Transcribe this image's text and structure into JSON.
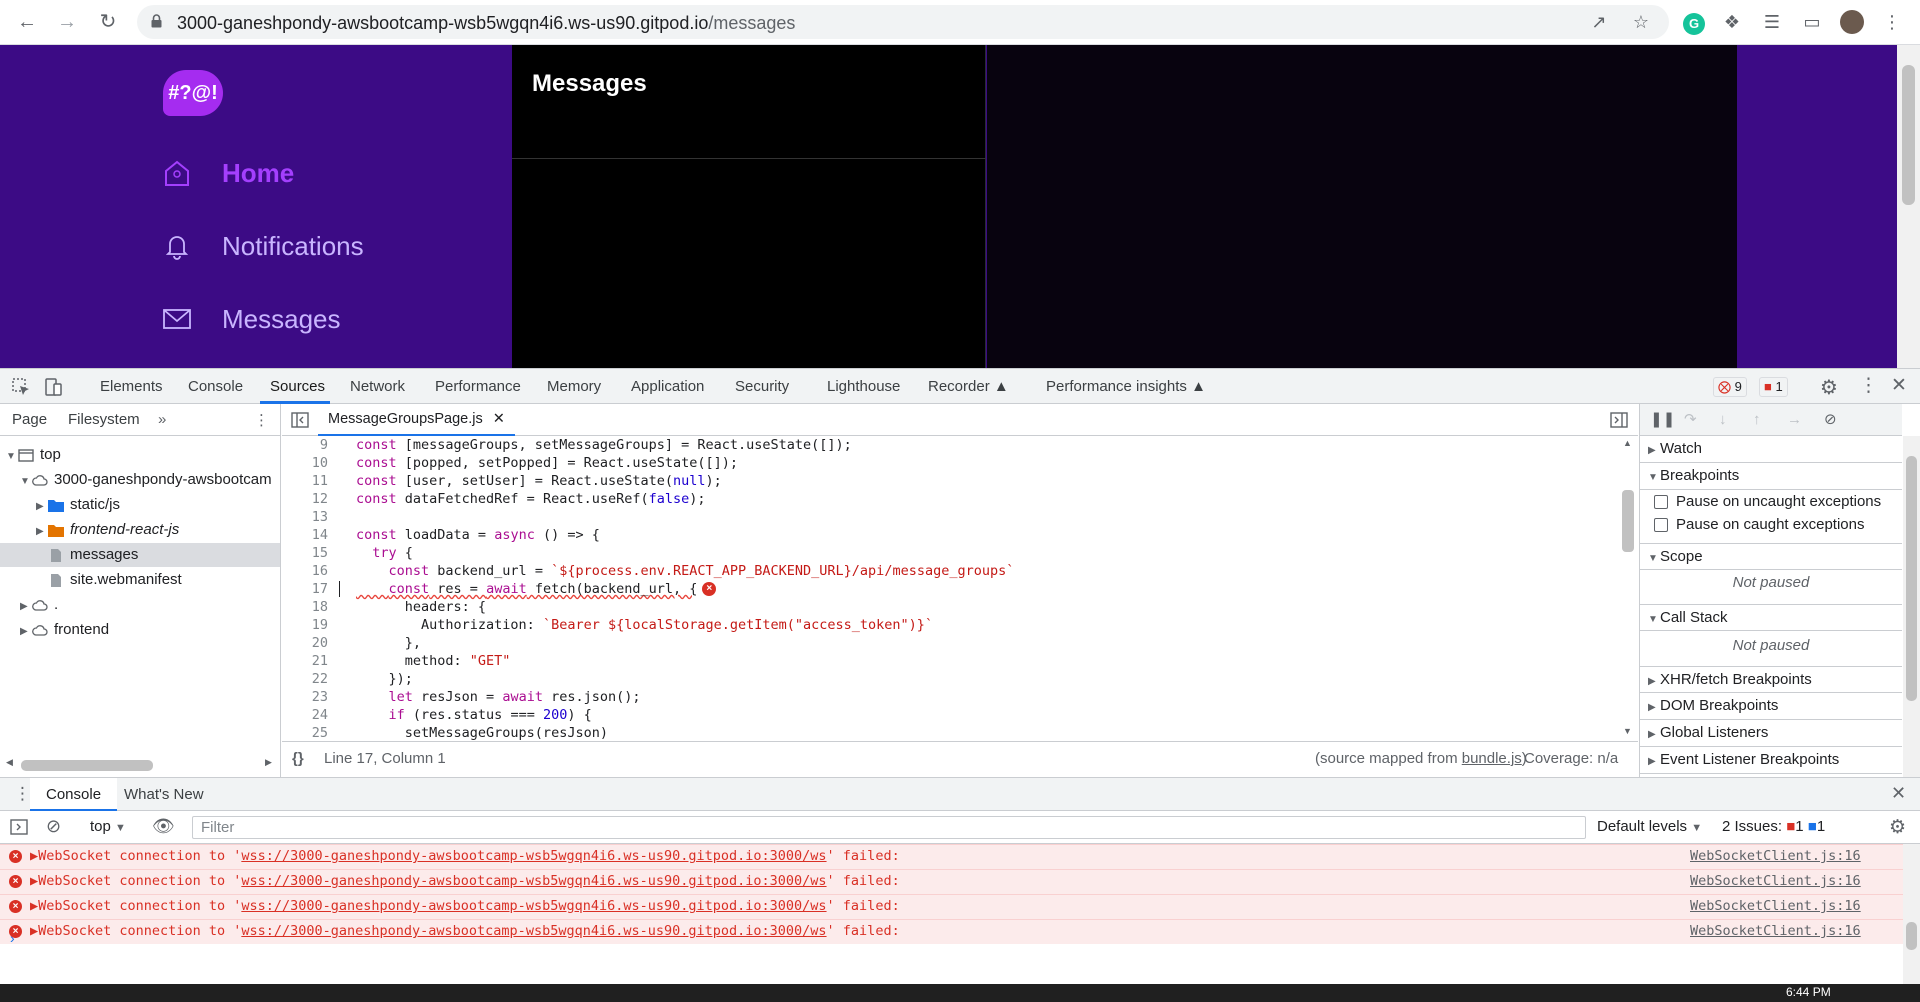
{
  "browser": {
    "url_host": "3000-ganeshpondy-awsbootcamp-wsb5wgqn4i6.ws-us90.gitpod.io",
    "url_path": "/messages"
  },
  "app": {
    "logo_text": "#?@!",
    "nav": [
      {
        "label": "Home",
        "icon": "home-icon",
        "active": true
      },
      {
        "label": "Notifications",
        "icon": "bell-icon",
        "active": false
      },
      {
        "label": "Messages",
        "icon": "envelope-icon",
        "active": false
      }
    ],
    "messages_title": "Messages"
  },
  "devtools": {
    "tabs": [
      "Elements",
      "Console",
      "Sources",
      "Network",
      "Performance",
      "Memory",
      "Application",
      "Security",
      "Lighthouse",
      "Recorder",
      "Performance insights"
    ],
    "active_tab": "Sources",
    "error_count": "9",
    "issue_count": "1",
    "navigator_tabs": [
      "Page",
      "Filesystem"
    ],
    "tree": [
      {
        "label": "top",
        "level": 0,
        "icon": "frame-icon",
        "arrow": "open"
      },
      {
        "label": "3000-ganeshpondy-awsbootcam",
        "level": 1,
        "icon": "cloud-icon",
        "arrow": "open"
      },
      {
        "label": "static/js",
        "level": 2,
        "icon": "folder-icon",
        "arrow": "closed"
      },
      {
        "label": "frontend-react-js",
        "level": 2,
        "icon": "folder-icon",
        "arrow": "closed"
      },
      {
        "label": "messages",
        "level": 2,
        "icon": "file-icon",
        "arrow": "none"
      },
      {
        "label": "site.webmanifest",
        "level": 2,
        "icon": "file-icon",
        "arrow": "none"
      },
      {
        "label": ".",
        "level": 1,
        "icon": "cloud-icon",
        "arrow": "closed"
      },
      {
        "label": "frontend",
        "level": 1,
        "icon": "cloud-icon",
        "arrow": "closed"
      }
    ],
    "editor_tab": "MessageGroupsPage.js",
    "code_lines": [
      {
        "n": "9",
        "t": "const [messageGroups, setMessageGroups] = React.useState([]);"
      },
      {
        "n": "10",
        "t": "const [popped, setPopped] = React.useState([]);"
      },
      {
        "n": "11",
        "t": "const [user, setUser] = React.useState(null);"
      },
      {
        "n": "12",
        "t": "const dataFetchedRef = React.useRef(false);"
      },
      {
        "n": "13",
        "t": ""
      },
      {
        "n": "14",
        "t": "const loadData = async () => {"
      },
      {
        "n": "15",
        "t": "  try {"
      },
      {
        "n": "16",
        "t": "    const backend_url = `${process.env.REACT_APP_BACKEND_URL}/api/message_groups`"
      },
      {
        "n": "17",
        "t": "    const res = await fetch(backend_url, {"
      },
      {
        "n": "18",
        "t": "      headers: {"
      },
      {
        "n": "19",
        "t": "        Authorization: `Bearer ${localStorage.getItem(\"access_token\")}`"
      },
      {
        "n": "20",
        "t": "      },"
      },
      {
        "n": "21",
        "t": "      method: \"GET\""
      },
      {
        "n": "22",
        "t": "    });"
      },
      {
        "n": "23",
        "t": "    let resJson = await res.json();"
      },
      {
        "n": "24",
        "t": "    if (res.status === 200) {"
      },
      {
        "n": "25",
        "t": "      setMessageGroups(resJson)"
      }
    ],
    "cursor_position": "Line 17, Column 1",
    "source_mapped_prefix": "(source mapped from",
    "source_mapped_file": "bundle.js",
    "source_mapped_suffix": ")",
    "coverage": "Coverage: n/a",
    "debugger": {
      "watch": "Watch",
      "breakpoints": "Breakpoints",
      "pause_uncaught": "Pause on uncaught exceptions",
      "pause_caught": "Pause on caught exceptions",
      "scope": "Scope",
      "not_paused": "Not paused",
      "call_stack": "Call Stack",
      "xhr": "XHR/fetch Breakpoints",
      "dom": "DOM Breakpoints",
      "global": "Global Listeners",
      "event": "Event Listener Breakpoints"
    }
  },
  "console": {
    "tabs": [
      "Console",
      "What's New"
    ],
    "context": "top",
    "filter_placeholder": "Filter",
    "levels": "Default levels",
    "issues_label": "2 Issues:",
    "issues_errors": "1",
    "issues_info": "1",
    "messages": [
      {
        "pre": "WebSocket connection to '",
        "link": "wss://3000-ganeshpondy-awsbootcamp-wsb5wgqn4i6.ws-us90.gitpod.io:3000/ws",
        "post": "' failed:",
        "source": "WebSocketClient.js:16"
      },
      {
        "pre": "WebSocket connection to '",
        "link": "wss://3000-ganeshpondy-awsbootcamp-wsb5wgqn4i6.ws-us90.gitpod.io:3000/ws",
        "post": "' failed:",
        "source": "WebSocketClient.js:16"
      },
      {
        "pre": "WebSocket connection to '",
        "link": "wss://3000-ganeshpondy-awsbootcamp-wsb5wgqn4i6.ws-us90.gitpod.io:3000/ws",
        "post": "' failed:",
        "source": "WebSocketClient.js:16"
      },
      {
        "pre": "WebSocket connection to '",
        "link": "wss://3000-ganeshpondy-awsbootcamp-wsb5wgqn4i6.ws-us90.gitpod.io:3000/ws",
        "post": "' failed:",
        "source": "WebSocketClient.js:16"
      }
    ]
  },
  "taskbar": {
    "time": "6:44 PM"
  },
  "colors": {
    "app_bg": "#3c0b85",
    "active_nav": "#a43ffe",
    "error": "#d93025",
    "accent": "#1a73e8"
  }
}
